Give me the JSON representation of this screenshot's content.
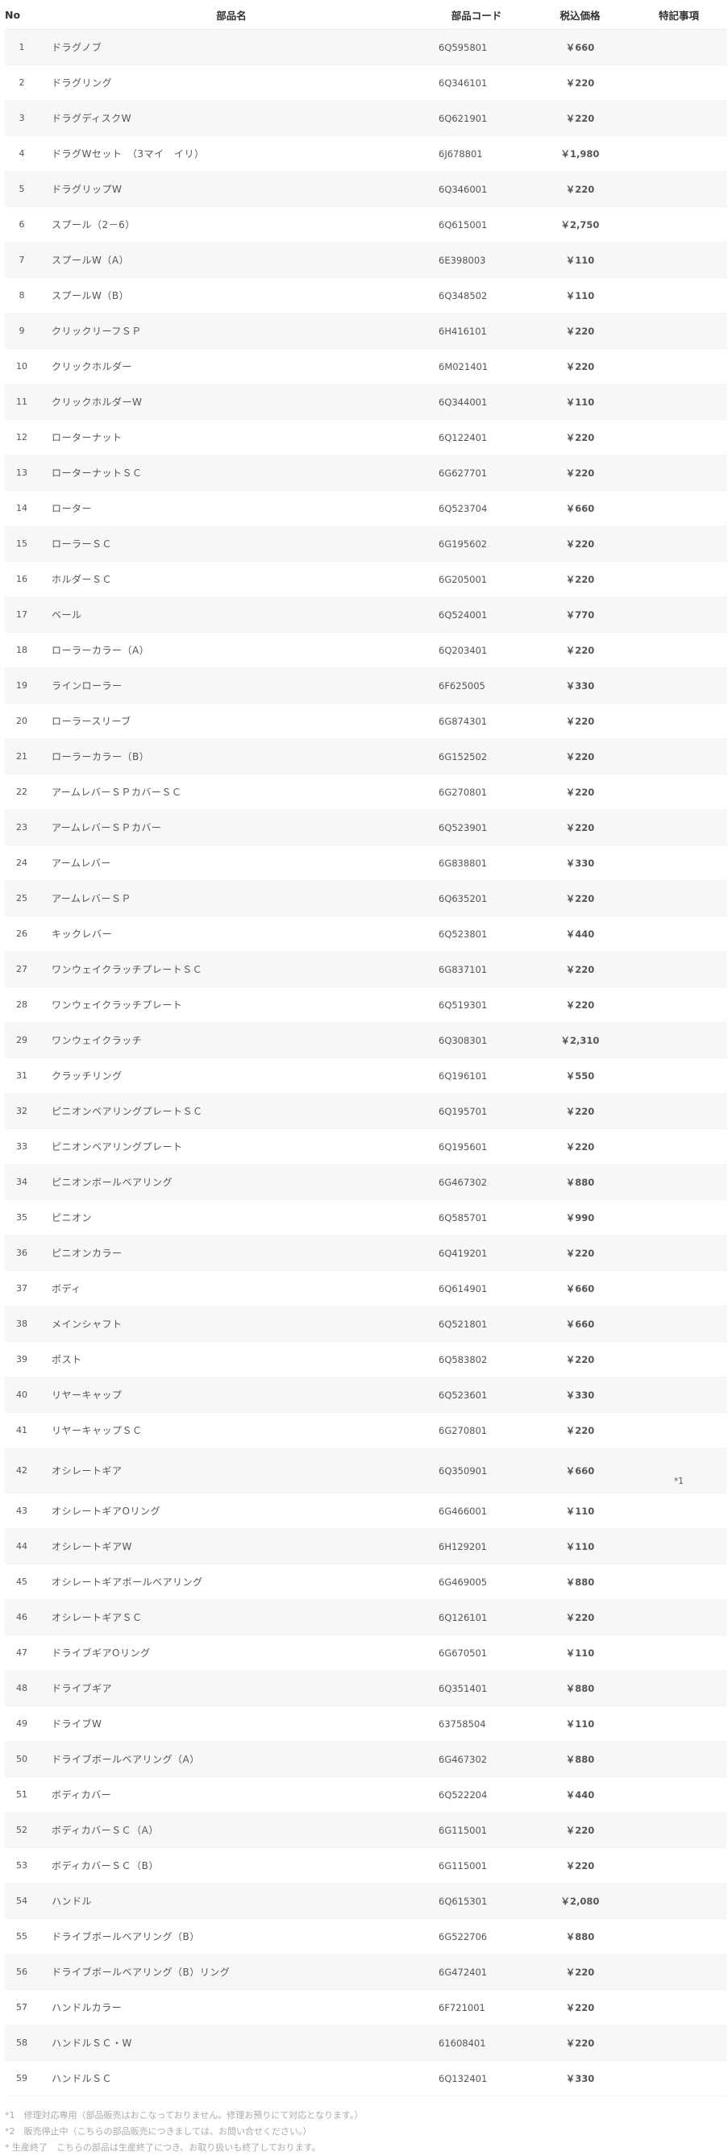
{
  "table": {
    "headers": {
      "no": "No",
      "name": "部品名",
      "code": "部品コード",
      "price": "税込価格",
      "note": "特記事項"
    },
    "rows": [
      {
        "no": "1",
        "name": "ドラグノブ",
        "code": "6Q595801",
        "price": "￥660",
        "note": ""
      },
      {
        "no": "2",
        "name": "ドラグリング",
        "code": "6Q346101",
        "price": "￥220",
        "note": ""
      },
      {
        "no": "3",
        "name": "ドラグディスクW",
        "code": "6Q621901",
        "price": "￥220",
        "note": ""
      },
      {
        "no": "4",
        "name": "ドラグWセット　（3マイ　イリ）",
        "code": "6J678801",
        "price": "￥1,980",
        "note": ""
      },
      {
        "no": "5",
        "name": "ドラグリップW",
        "code": "6Q346001",
        "price": "￥220",
        "note": ""
      },
      {
        "no": "6",
        "name": "スプール（2－6）",
        "code": "6Q615001",
        "price": "￥2,750",
        "note": ""
      },
      {
        "no": "7",
        "name": "スプールW（A）",
        "code": "6E398003",
        "price": "￥110",
        "note": ""
      },
      {
        "no": "8",
        "name": "スプールW（B）",
        "code": "6Q348502",
        "price": "￥110",
        "note": ""
      },
      {
        "no": "9",
        "name": "クリックリーフＳＰ",
        "code": "6H416101",
        "price": "￥220",
        "note": ""
      },
      {
        "no": "10",
        "name": "クリックホルダー",
        "code": "6M021401",
        "price": "￥220",
        "note": ""
      },
      {
        "no": "11",
        "name": "クリックホルダーW",
        "code": "6Q344001",
        "price": "￥110",
        "note": ""
      },
      {
        "no": "12",
        "name": "ローターナット",
        "code": "6Q122401",
        "price": "￥220",
        "note": ""
      },
      {
        "no": "13",
        "name": "ローターナットＳＣ",
        "code": "6G627701",
        "price": "￥220",
        "note": ""
      },
      {
        "no": "14",
        "name": "ローター",
        "code": "6Q523704",
        "price": "￥660",
        "note": ""
      },
      {
        "no": "15",
        "name": "ローラーＳＣ",
        "code": "6G195602",
        "price": "￥220",
        "note": ""
      },
      {
        "no": "16",
        "name": "ホルダーＳＣ",
        "code": "6G205001",
        "price": "￥220",
        "note": ""
      },
      {
        "no": "17",
        "name": "ベール",
        "code": "6Q524001",
        "price": "￥770",
        "note": ""
      },
      {
        "no": "18",
        "name": "ローラーカラー（A）",
        "code": "6Q203401",
        "price": "￥220",
        "note": ""
      },
      {
        "no": "19",
        "name": "ラインローラー",
        "code": "6F625005",
        "price": "￥330",
        "note": ""
      },
      {
        "no": "20",
        "name": "ローラースリーブ",
        "code": "6G874301",
        "price": "￥220",
        "note": ""
      },
      {
        "no": "21",
        "name": "ローラーカラー（B）",
        "code": "6G152502",
        "price": "￥220",
        "note": ""
      },
      {
        "no": "22",
        "name": "アームレバーＳＰカバーＳＣ",
        "code": "6G270801",
        "price": "￥220",
        "note": ""
      },
      {
        "no": "23",
        "name": "アームレバーＳＰカバー",
        "code": "6Q523901",
        "price": "￥220",
        "note": ""
      },
      {
        "no": "24",
        "name": "アームレバー",
        "code": "6G838801",
        "price": "￥330",
        "note": ""
      },
      {
        "no": "25",
        "name": "アームレバーＳＰ",
        "code": "6Q635201",
        "price": "￥220",
        "note": ""
      },
      {
        "no": "26",
        "name": "キックレバー",
        "code": "6Q523801",
        "price": "￥440",
        "note": ""
      },
      {
        "no": "27",
        "name": "ワンウェイクラッチプレートＳＣ",
        "code": "6G837101",
        "price": "￥220",
        "note": ""
      },
      {
        "no": "28",
        "name": "ワンウェイクラッチプレート",
        "code": "6Q519301",
        "price": "￥220",
        "note": ""
      },
      {
        "no": "29",
        "name": "ワンウェイクラッチ",
        "code": "6Q308301",
        "price": "￥2,310",
        "note": ""
      },
      {
        "no": "31",
        "name": "クラッチリング",
        "code": "6Q196101",
        "price": "￥550",
        "note": ""
      },
      {
        "no": "32",
        "name": "ピニオンベアリングプレートＳＣ",
        "code": "6Q195701",
        "price": "￥220",
        "note": ""
      },
      {
        "no": "33",
        "name": "ピニオンベアリングプレート",
        "code": "6Q195601",
        "price": "￥220",
        "note": ""
      },
      {
        "no": "34",
        "name": "ピニオンボールベアリング",
        "code": "6G467302",
        "price": "￥880",
        "note": ""
      },
      {
        "no": "35",
        "name": "ピニオン",
        "code": "6Q585701",
        "price": "￥990",
        "note": ""
      },
      {
        "no": "36",
        "name": "ピニオンカラー",
        "code": "6Q419201",
        "price": "￥220",
        "note": ""
      },
      {
        "no": "37",
        "name": "ボディ",
        "code": "6Q614901",
        "price": "￥660",
        "note": ""
      },
      {
        "no": "38",
        "name": "メインシャフト",
        "code": "6Q521801",
        "price": "￥660",
        "note": ""
      },
      {
        "no": "39",
        "name": "ポスト",
        "code": "6Q583802",
        "price": "￥220",
        "note": ""
      },
      {
        "no": "40",
        "name": "リヤーキャップ",
        "code": "6Q523601",
        "price": "￥330",
        "note": ""
      },
      {
        "no": "41",
        "name": "リヤーキャップＳＣ",
        "code": "6G270801",
        "price": "￥220",
        "note": ""
      },
      {
        "no": "42",
        "name": "オシレートギア",
        "code": "6Q350901",
        "price": "￥660",
        "note": "*1"
      },
      {
        "no": "43",
        "name": "オシレートギアOリング",
        "code": "6G466001",
        "price": "￥110",
        "note": ""
      },
      {
        "no": "44",
        "name": "オシレートギアW",
        "code": "6H129201",
        "price": "￥110",
        "note": ""
      },
      {
        "no": "45",
        "name": "オシレートギアボールベアリング",
        "code": "6G469005",
        "price": "￥880",
        "note": ""
      },
      {
        "no": "46",
        "name": "オシレートギアＳＣ",
        "code": "6Q126101",
        "price": "￥220",
        "note": ""
      },
      {
        "no": "47",
        "name": "ドライブギアOリング",
        "code": "6G670501",
        "price": "￥110",
        "note": ""
      },
      {
        "no": "48",
        "name": "ドライブギア",
        "code": "6Q351401",
        "price": "￥880",
        "note": ""
      },
      {
        "no": "49",
        "name": "ドライブW",
        "code": "63758504",
        "price": "￥110",
        "note": ""
      },
      {
        "no": "50",
        "name": "ドライブボールベアリング（A）",
        "code": "6G467302",
        "price": "￥880",
        "note": ""
      },
      {
        "no": "51",
        "name": "ボディカバー",
        "code": "6Q522204",
        "price": "￥440",
        "note": ""
      },
      {
        "no": "52",
        "name": "ボディカバーＳＣ（A）",
        "code": "6G115001",
        "price": "￥220",
        "note": ""
      },
      {
        "no": "53",
        "name": "ボディカバーＳＣ（B）",
        "code": "6G115001",
        "price": "￥220",
        "note": ""
      },
      {
        "no": "54",
        "name": "ハンドル",
        "code": "6Q615301",
        "price": "￥2,080",
        "note": ""
      },
      {
        "no": "55",
        "name": "ドライブボールベアリング（B）",
        "code": "6G522706",
        "price": "￥880",
        "note": ""
      },
      {
        "no": "56",
        "name": "ドライブボールベアリング（B）リング",
        "code": "6G472401",
        "price": "￥220",
        "note": ""
      },
      {
        "no": "57",
        "name": "ハンドルカラー",
        "code": "6F721001",
        "price": "￥220",
        "note": ""
      },
      {
        "no": "58",
        "name": "ハンドルＳＣ・W",
        "code": "61608401",
        "price": "￥220",
        "note": ""
      },
      {
        "no": "59",
        "name": "ハンドルＳＣ",
        "code": "6Q132401",
        "price": "￥330",
        "note": ""
      }
    ]
  },
  "footnotes": [
    "*1　修理対応専用（部品販売はおこなっておりません。修理お預りにて対応となります。）",
    "*2　販売停止中（こちらの部品販売につきましては、お問い合せください。）",
    "* 生産終了　こちらの部品は生産終了につき、お取り扱いも終了しております。"
  ]
}
